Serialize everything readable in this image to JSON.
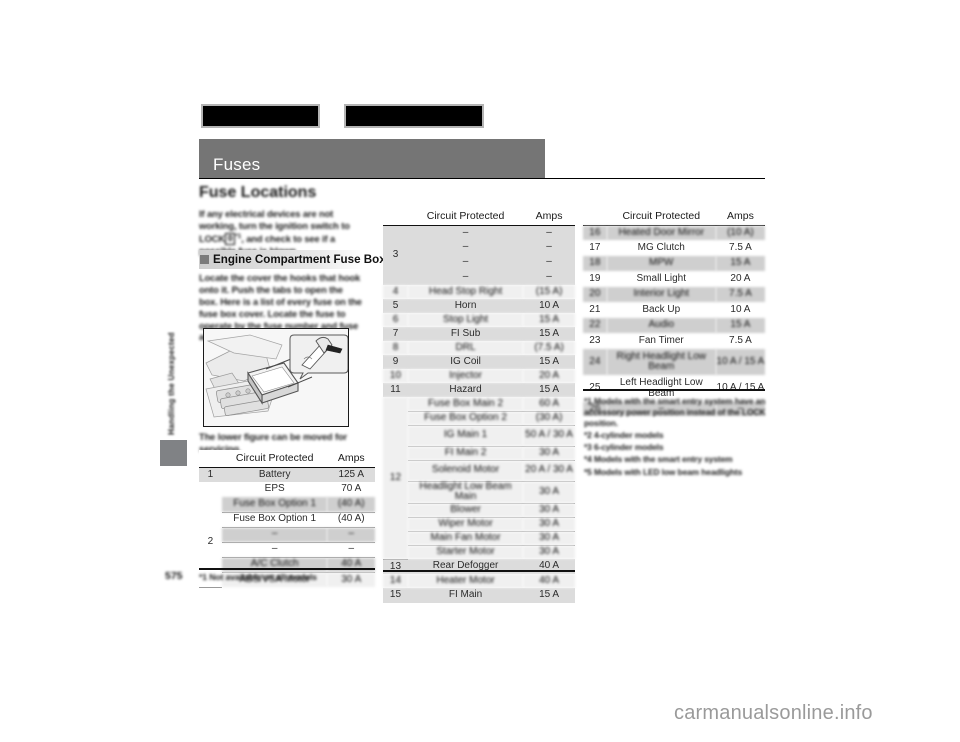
{
  "document": {
    "section_band_title": "Fuses",
    "section_title": "Fuse Locations",
    "page_number": "575",
    "vertical_tab": "Handling the Unexpected",
    "watermark": "carmanualsonline.info"
  },
  "left_column": {
    "intro_paragraph_pre": "If any electrical devices are not working, turn the ignition switch to LOCK",
    "intro_key_symbol": "0",
    "intro_key_sup": "*1",
    "intro_paragraph_post": ", and check to see if a possible fuse is blown.",
    "subhead_label": "Engine Compartment Fuse Box",
    "subcopy_1": "Locate the cover the hooks that hook onto it. Push the tabs to open the box. Here is a list of every fuse on the fuse box cover. Locate the fuse to operate by the fuse number and fuse amp number.",
    "figure_caption": "The lower figure can be moved for servicing."
  },
  "table_left": {
    "headers": [
      "",
      "Circuit Protected",
      "Amps"
    ],
    "rows": [
      {
        "no": "1",
        "circuit": "Battery",
        "amps": "125 A",
        "shade": "shade",
        "redacted": false
      },
      {
        "no": "",
        "circuit": "EPS",
        "amps": "70 A",
        "shade": "plain",
        "redacted": false
      },
      {
        "no": "",
        "circuit": "Fuse Box Option 1",
        "amps": "(40 A)",
        "shade": "shade",
        "redacted": true
      },
      {
        "no": "",
        "circuit": "Fuse Box Option 1",
        "amps": "(40 A)",
        "shade": "plain",
        "redacted": false
      },
      {
        "no": "2",
        "circuit": "–",
        "amps": "–",
        "shade": "shade",
        "redacted": true
      },
      {
        "no": "",
        "circuit": "–",
        "amps": "–",
        "shade": "plain",
        "redacted": false
      },
      {
        "no": "",
        "circuit": "A/C Clutch",
        "amps": "40 A",
        "shade": "shade",
        "redacted": true
      },
      {
        "no": "",
        "circuit": "ABS/VSA Motor",
        "amps": "30 A",
        "shade": "plain",
        "redacted": true
      }
    ],
    "note": "*1 Not available on all models"
  },
  "table_middle": {
    "headers": [
      "",
      "Circuit Protected",
      "Amps"
    ],
    "rows": [
      {
        "no": "3",
        "circuit": "–",
        "amps": "–",
        "shade": "shade",
        "redacted": false,
        "group": 4
      },
      {
        "no": "4",
        "circuit": "Head Stop Right",
        "amps": "(15 A)",
        "shade": "plain",
        "redacted": true
      },
      {
        "no": "5",
        "circuit": "Horn",
        "amps": "10 A",
        "shade": "shade",
        "redacted": false
      },
      {
        "no": "6",
        "circuit": "Stop Light",
        "amps": "15 A",
        "shade": "plain",
        "redacted": true
      },
      {
        "no": "7",
        "circuit": "FI Sub",
        "amps": "15 A",
        "shade": "shade",
        "redacted": false
      },
      {
        "no": "8",
        "circuit": "DRL",
        "amps": "(7.5 A)",
        "shade": "plain",
        "redacted": true
      },
      {
        "no": "9",
        "circuit": "IG Coil",
        "amps": "15 A",
        "shade": "shade",
        "redacted": false
      },
      {
        "no": "10",
        "circuit": "Injector",
        "amps": "20 A",
        "shade": "plain",
        "redacted": true
      },
      {
        "no": "11",
        "circuit": "Hazard",
        "amps": "15 A",
        "shade": "shade",
        "redacted": false
      },
      {
        "no": "",
        "circuit": "Fuse Box Main 2",
        "amps": "60 A",
        "shade": "plain",
        "redacted": true
      },
      {
        "no": "",
        "circuit": "Fuse Box Option 2",
        "amps": "(30 A)",
        "shade": "plain",
        "redacted": true
      },
      {
        "no": "",
        "circuit": "IG Main 1",
        "amps": "50 A / 30 A",
        "shade": "plain",
        "redacted": true
      },
      {
        "no": "",
        "circuit": "FI Main 2",
        "amps": "30 A",
        "shade": "plain",
        "redacted": true
      },
      {
        "no": "12",
        "circuit": "Solenoid Motor",
        "amps": "20 A / 30 A",
        "shade": "plain",
        "redacted": true
      },
      {
        "no": "",
        "circuit": "Headlight Low Beam Main",
        "amps": "30 A",
        "shade": "plain",
        "redacted": true
      },
      {
        "no": "",
        "circuit": "Blower",
        "amps": "30 A",
        "shade": "plain",
        "redacted": true
      },
      {
        "no": "",
        "circuit": "Wiper Motor",
        "amps": "30 A",
        "shade": "plain",
        "redacted": true
      },
      {
        "no": "",
        "circuit": "Main Fan Motor",
        "amps": "30 A",
        "shade": "plain",
        "redacted": true
      },
      {
        "no": "",
        "circuit": "Starter Motor",
        "amps": "30 A",
        "shade": "plain",
        "redacted": true
      },
      {
        "no": "13",
        "circuit": "Rear Defogger",
        "amps": "40 A",
        "shade": "shade",
        "redacted": false
      },
      {
        "no": "14",
        "circuit": "Heater Motor",
        "amps": "40 A",
        "shade": "plain",
        "redacted": true
      },
      {
        "no": "15",
        "circuit": "FI Main",
        "amps": "15 A",
        "shade": "shade",
        "redacted": false
      }
    ]
  },
  "table_right": {
    "headers": [
      "",
      "Circuit Protected",
      "Amps"
    ],
    "rows": [
      {
        "no": "16",
        "circuit": "Heated Door Mirror",
        "amps": "(10 A)",
        "shade": "shade",
        "redacted": true
      },
      {
        "no": "17",
        "circuit": "MG Clutch",
        "amps": "7.5 A",
        "shade": "plain",
        "redacted": false
      },
      {
        "no": "18",
        "circuit": "MPW",
        "amps": "15 A",
        "shade": "shade",
        "redacted": true
      },
      {
        "no": "19",
        "circuit": "Small Light",
        "amps": "20 A",
        "shade": "plain",
        "redacted": false
      },
      {
        "no": "20",
        "circuit": "Interior Light",
        "amps": "7.5 A",
        "shade": "shade",
        "redacted": true
      },
      {
        "no": "21",
        "circuit": "Back Up",
        "amps": "10 A",
        "shade": "plain",
        "redacted": false
      },
      {
        "no": "22",
        "circuit": "Audio",
        "amps": "15 A",
        "shade": "shade",
        "redacted": true
      },
      {
        "no": "23",
        "circuit": "Fan Timer",
        "amps": "7.5 A",
        "shade": "plain",
        "redacted": false
      },
      {
        "no": "24",
        "circuit": "Right Headlight Low Beam",
        "amps": "10 A / 15 A",
        "shade": "shade",
        "redacted": true
      },
      {
        "no": "25",
        "circuit": "Left Headlight Low Beam",
        "amps": "10 A / 15 A",
        "shade": "plain",
        "redacted": false
      },
      {
        "no": "26",
        "circuit": "–",
        "amps": "–",
        "shade": "shade",
        "redacted": true
      }
    ],
    "footnotes": [
      "*1 Models with the smart entry system have an accessory power position instead of the LOCK position.",
      "*2 4-cylinder models",
      "*3 6-cylinder models",
      "*4 Models with the smart entry system",
      "*5 Models with LED low beam headlights"
    ]
  }
}
